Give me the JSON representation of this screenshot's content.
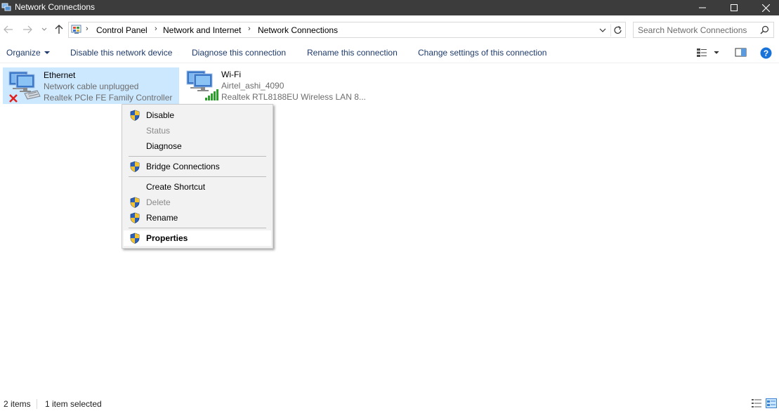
{
  "window": {
    "title": "Network Connections"
  },
  "address": {
    "crumbs": [
      "Control Panel",
      "Network and Internet",
      "Network Connections"
    ],
    "search_placeholder": "Search Network Connections"
  },
  "toolbar": {
    "organize": "Organize",
    "disable": "Disable this network device",
    "diagnose": "Diagnose this connection",
    "rename": "Rename this connection",
    "change_settings": "Change settings of this connection"
  },
  "connections": [
    {
      "name": "Ethernet",
      "status": "Network cable unplugged",
      "device": "Realtek PCIe FE Family Controller",
      "selected": true
    },
    {
      "name": "Wi-Fi",
      "status": "Airtel_ashi_4090",
      "device": "Realtek RTL8188EU Wireless LAN 8...",
      "selected": false
    }
  ],
  "context_menu": {
    "items": [
      {
        "label": "Disable",
        "shield": true,
        "disabled": false
      },
      {
        "label": "Status",
        "shield": false,
        "disabled": true
      },
      {
        "label": "Diagnose",
        "shield": false,
        "disabled": false
      },
      {
        "label": "Bridge Connections",
        "shield": true,
        "disabled": false
      },
      {
        "label": "Create Shortcut",
        "shield": false,
        "disabled": false
      },
      {
        "label": "Delete",
        "shield": true,
        "disabled": true
      },
      {
        "label": "Rename",
        "shield": true,
        "disabled": false
      },
      {
        "label": "Properties",
        "shield": true,
        "disabled": false,
        "bold": true
      }
    ]
  },
  "status_bar": {
    "count": "2 items",
    "selection": "1 item selected"
  },
  "colors": {
    "titlebar": "#3c3c3c",
    "selection": "#cce8ff",
    "command_text": "#1e3a6b",
    "help_blue": "#1a73d9"
  }
}
